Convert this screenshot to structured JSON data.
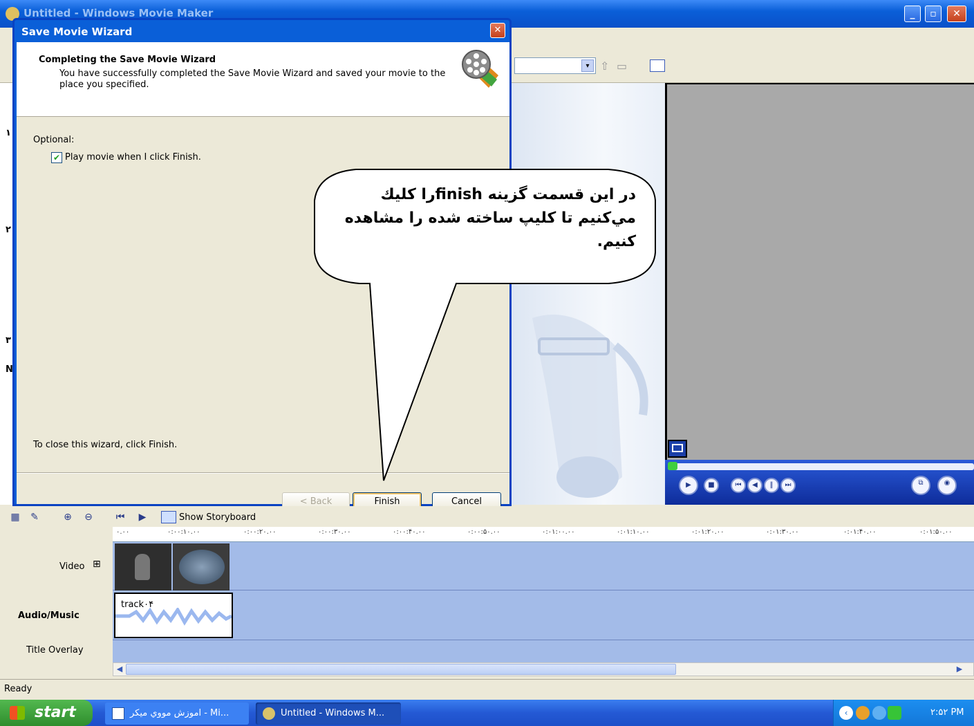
{
  "main_window": {
    "title": "Untitled - Windows Movie Maker",
    "minimize": "_",
    "maximize": "▫",
    "close": "✕"
  },
  "wizard": {
    "title": "Save Movie Wizard",
    "heading": "Completing the Save Movie Wizard",
    "subheading": "You have successfully completed the Save Movie Wizard and saved your movie to the place you specified.",
    "optional_label": "Optional:",
    "checkbox_label": "Play movie when I click Finish.",
    "checkbox_checked": true,
    "close_note": "To close this wizard, click Finish.",
    "back_label": "< Back",
    "finish_label": "Finish",
    "cancel_label": "Cancel"
  },
  "balloon": {
    "text": "در اين قسمت گزينه finishرا كليك مي‌كنيم تا كليپ ساخته شده را مشاهده كنيم."
  },
  "left_pane_numbers": [
    "۱",
    "۲",
    "۳",
    "N"
  ],
  "timeline": {
    "show_storyboard": "Show Storyboard",
    "ruler": [
      "۰.۰۰",
      "۰:۰۰:۱۰.۰۰",
      "۰:۰۰:۲۰.۰۰",
      "۰:۰۰:۳۰.۰۰",
      "۰:۰۰:۴۰.۰۰",
      "۰:۰۰:۵۰.۰۰",
      "۰:۰۱:۰۰.۰۰",
      "۰:۰۱:۱۰.۰۰",
      "۰:۰۱:۲۰.۰۰",
      "۰:۰۱:۳۰.۰۰",
      "۰:۰۱:۴۰.۰۰",
      "۰:۰۱:۵۰.۰۰"
    ],
    "tracks": {
      "video": "Video",
      "audio": "Audio/Music",
      "title": "Title Overlay"
    },
    "expand": "⊞",
    "audio_clip": "track۰۴"
  },
  "status": {
    "text": "Ready"
  },
  "taskbar": {
    "start": "start",
    "tasks": [
      "اموزش مووي ميكر - Mi...",
      "Untitled - Windows M..."
    ],
    "clock": "۲:۵۲ PM"
  },
  "colors": {
    "xp_blue": "#0a5fd8",
    "preview_gray": "#a9a9a9",
    "timeline_blue": "#a3bbe8"
  }
}
